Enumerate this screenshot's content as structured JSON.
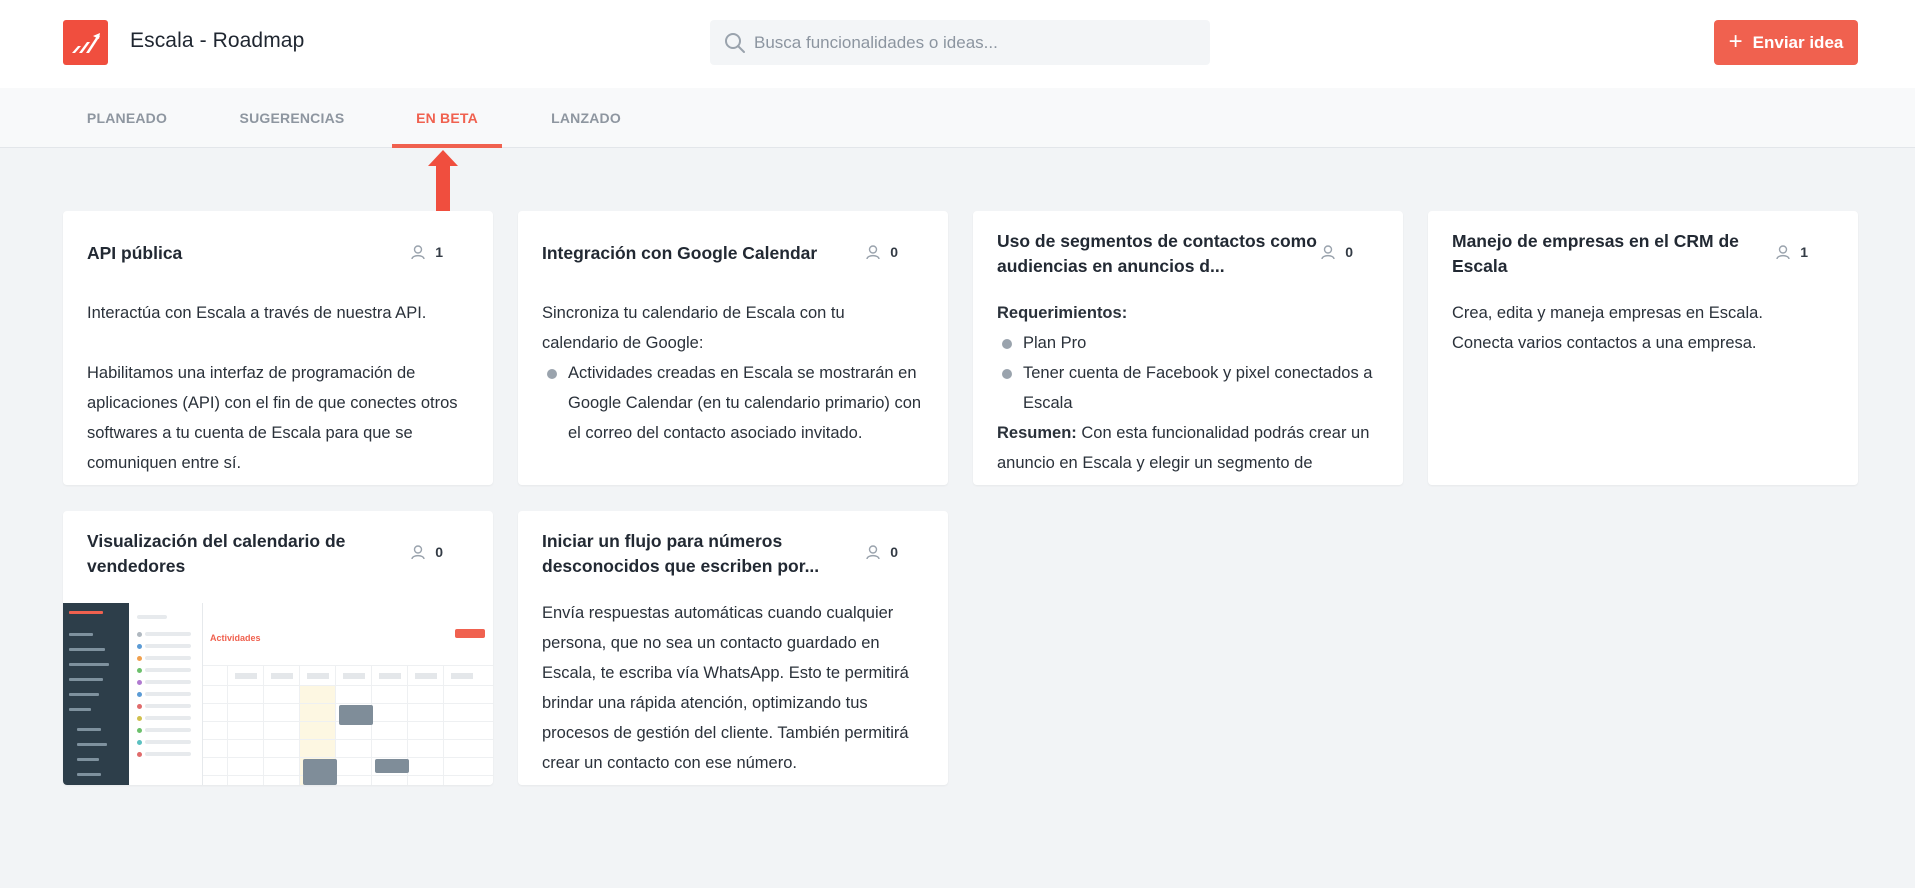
{
  "header": {
    "app_title": "Escala - Roadmap",
    "search_placeholder": "Busca funcionalidades o ideas...",
    "send_button_label": "Enviar idea",
    "brand_color": "#f04e3e"
  },
  "tabs": [
    {
      "label": "PLANEADO",
      "active": false
    },
    {
      "label": "SUGERENCIAS",
      "active": false
    },
    {
      "label": "EN BETA",
      "active": true
    },
    {
      "label": "LANZADO",
      "active": false
    }
  ],
  "cards": [
    {
      "title": "API pública",
      "votes": "1",
      "body_1": "Interactúa con Escala a través de nuestra API.",
      "body_2": "Habilitamos una interfaz de programación de aplicaciones (API) con el fin de que conectes otros softwares a tu cuenta de Escala para que se comuniquen entre sí."
    },
    {
      "title": "Integración con Google Calendar",
      "votes": "0",
      "body_1": "Sincroniza  tu calendario de Escala con tu calendario de Google:",
      "bullet_1": "Actividades creadas en Escala se mostrarán en Google Calendar (en tu calendario primario) con el correo del contacto asociado invitado."
    },
    {
      "title": "Uso de segmentos de contactos como audiencias en anuncios d...",
      "votes": "0",
      "req_label": "Requerimientos:",
      "bullet_1": "Plan Pro",
      "bullet_2": "Tener cuenta de Facebook y pixel conectados a Escala",
      "summary_label": "Resumen:",
      "summary_text": " Con esta funcionalidad podrás crear un anuncio en Escala y elegir un segmento de contactos."
    },
    {
      "title": "Manejo de empresas en el CRM de Escala",
      "votes": "1",
      "body_1": "Crea, edita y maneja empresas en Escala.",
      "body_2": "Conecta varios contactos a una empresa."
    },
    {
      "title": "Visualización del calendario de vendedores",
      "votes": "0",
      "thumb_title": "Actividades"
    },
    {
      "title": "Iniciar un flujo para números desconocidos que escriben por...",
      "votes": "0",
      "body_1": "Envía respuestas automáticas cuando cualquier persona, que no sea un contacto guardado en Escala, te escriba vía WhatsApp. Esto te permitirá brindar una rápida atención, optimizando tus procesos de gestión del cliente. También permitirá crear un contacto con ese número."
    }
  ]
}
